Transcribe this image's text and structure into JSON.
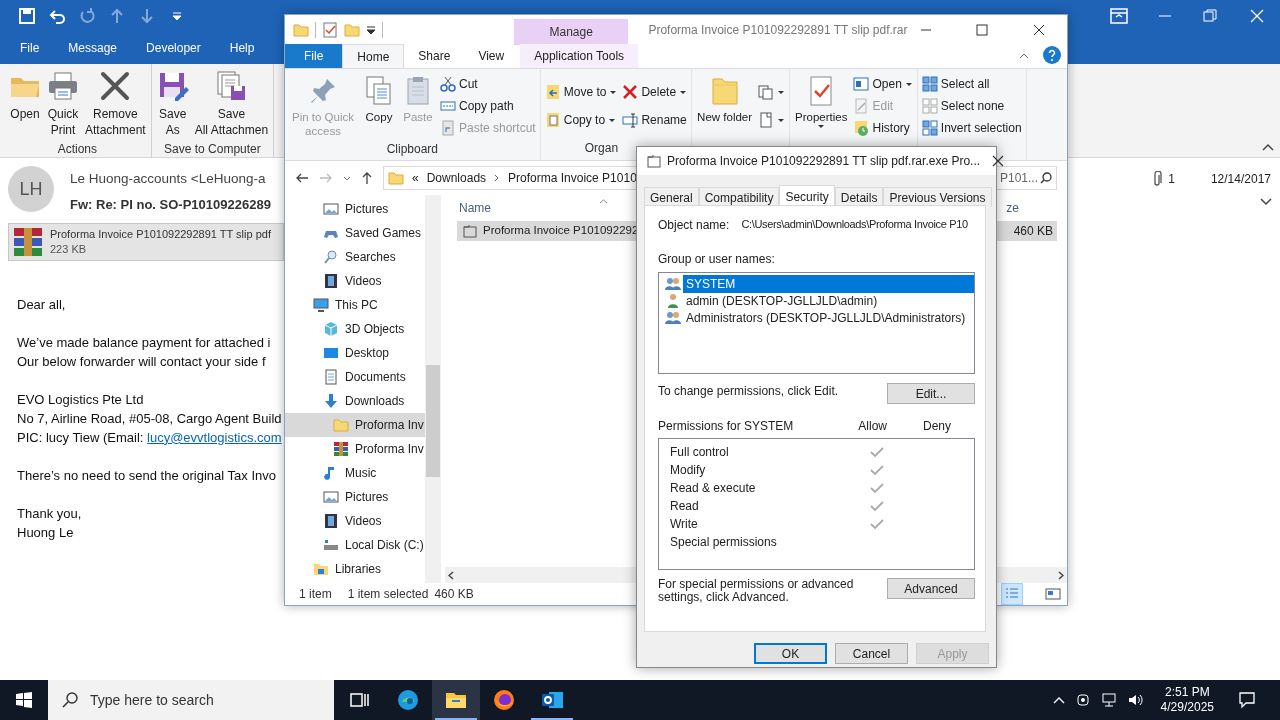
{
  "outlook": {
    "quick_access": [
      {
        "disabled": false
      },
      {
        "disabled": false
      },
      {
        "disabled": true
      },
      {
        "disabled": true
      },
      {
        "disabled": true
      },
      {
        "disabled": false
      }
    ],
    "menu_tabs": [
      {
        "label": "File"
      },
      {
        "label": "Message"
      },
      {
        "label": "Developer"
      },
      {
        "label": "Help"
      }
    ],
    "ribbon_groups": [
      {
        "label": "Actions",
        "buttons": [
          {
            "label": "Open"
          },
          {
            "label": "Quick Print"
          },
          {
            "label": "Remove Attachment"
          }
        ]
      },
      {
        "label": "Save to Computer",
        "buttons": [
          {
            "label": "Save As"
          },
          {
            "label": "Save All Attachmen"
          }
        ]
      }
    ],
    "message": {
      "avatar": "LH",
      "sender": "Le Huong-accounts <LeHuong-a",
      "subject": "Fw: Re: PI no. SO-P10109226289",
      "attachment_count": "1",
      "date": "12/14/2017",
      "attachment": {
        "name": "Proforma Invoice P101092292891 TT slip pdf",
        "size": "223 KB"
      },
      "body": [
        [
          {
            "text": "Dear all,"
          }
        ],
        [
          {
            "text": "We’ve made balance payment for attached i"
          },
          {
            "text": "Our below forwarder will contact your side f"
          }
        ],
        [
          {
            "text": "EVO Logistics Pte Ltd"
          },
          {
            "text": "No 7, Airline Road, #05-08, Cargo Agent Build"
          },
          {
            "text": "PIC: lucy Tiew (Email:",
            "link": "lucy@evvtlogistics.com"
          }
        ],
        [
          {
            "text": "There’s no need to send the original Tax Invo"
          }
        ],
        [
          {
            "text": "Thank you,"
          },
          {
            "text": "Huong Le"
          }
        ]
      ]
    }
  },
  "explorer": {
    "title": "Proforma Invoice P101092292891 TT slip pdf.rar",
    "context_group": "Manage",
    "tabs": [
      {
        "label": "File",
        "kind": "file",
        "selected": false
      },
      {
        "label": "Home",
        "kind": "tab",
        "selected": true
      },
      {
        "label": "Share",
        "kind": "tab",
        "selected": false
      },
      {
        "label": "View",
        "kind": "tab",
        "selected": false
      },
      {
        "label": "Application Tools",
        "kind": "context",
        "selected": false
      }
    ],
    "ribbon": [
      {
        "label": "Clipboard",
        "items": [
          {
            "kind": "large",
            "label": "Pin to Quick access",
            "disabled": true
          },
          {
            "kind": "large",
            "label": "Copy",
            "disabled": false
          },
          {
            "kind": "large",
            "label": "Paste",
            "disabled": true
          },
          {
            "kind": "stack",
            "items": [
              {
                "label": "Cut",
                "disabled": false
              },
              {
                "label": "Copy path",
                "disabled": false
              },
              {
                "label": "Paste shortcut",
                "disabled": true
              }
            ]
          }
        ]
      },
      {
        "label": "Organ",
        "items": [
          {
            "kind": "stack",
            "items": [
              {
                "label": "Move to",
                "dropdown": true
              },
              {
                "label": "Copy to",
                "dropdown": true
              }
            ]
          },
          {
            "kind": "stack",
            "items": [
              {
                "label": "Delete",
                "dropdown": true
              },
              {
                "label": "Rename"
              }
            ]
          }
        ]
      },
      {
        "items": [
          {
            "kind": "large",
            "label": "New folder"
          },
          {
            "kind": "stack",
            "items": [
              {
                "dropdown": true
              },
              {
                "dropdown": true
              }
            ]
          }
        ]
      },
      {
        "items": [
          {
            "kind": "large",
            "label": "Properties",
            "dropdown": true
          },
          {
            "kind": "stack",
            "items": [
              {
                "label": "Open",
                "dropdown": true
              },
              {
                "label": "Edit",
                "disabled": true
              },
              {
                "label": "History"
              }
            ]
          }
        ]
      },
      {
        "items": [
          {
            "kind": "stack",
            "items": [
              {
                "label": "Select all"
              },
              {
                "label": "Select none"
              },
              {
                "label": "Invert selection"
              }
            ]
          }
        ]
      }
    ],
    "address": {
      "overflow": "«",
      "crumbs": [
        "Downloads",
        "Proforma Invoice P1010"
      ]
    },
    "search": {
      "placeholder": "P101..."
    },
    "tree": [
      {
        "children": [
          {
            "label": "Pictures",
            "selected": false
          },
          {
            "label": "Saved Games",
            "selected": false
          },
          {
            "label": "Searches",
            "selected": false
          },
          {
            "label": "Videos",
            "selected": false
          }
        ]
      },
      {
        "label": "This PC",
        "selected": false,
        "children": [
          {
            "label": "3D Objects",
            "selected": false
          },
          {
            "label": "Desktop",
            "selected": false
          },
          {
            "label": "Documents",
            "selected": false
          },
          {
            "label": "Downloads",
            "selected": false,
            "children": [
              {
                "label": "Proforma Inv",
                "selected": true
              },
              {
                "label": "Proforma Inv",
                "selected": false
              }
            ]
          },
          {
            "label": "Music",
            "selected": false
          },
          {
            "label": "Pictures",
            "selected": false
          },
          {
            "label": "Videos",
            "selected": false
          },
          {
            "label": "Local Disk (C:)",
            "selected": false
          }
        ]
      },
      {
        "label": "Libraries",
        "selected": false
      }
    ],
    "columns": [
      {
        "label": "Name"
      },
      {
        "label": "ze"
      }
    ],
    "rows": [
      {
        "name": "Proforma Invoice P101092292",
        "size": "460 KB",
        "selected": true
      }
    ],
    "status": {
      "count": "1 item",
      "selection": "1 item selected",
      "size": "460 KB"
    },
    "view_buttons": [
      {
        "selected": true
      },
      {
        "selected": false
      }
    ]
  },
  "dialog": {
    "title": "Proforma Invoice P101092292891 TT slip pdf.rar.exe Pro...",
    "tabs": [
      {
        "label": "General",
        "selected": false
      },
      {
        "label": "Compatibility",
        "selected": false
      },
      {
        "label": "Security",
        "selected": true
      },
      {
        "label": "Details",
        "selected": false
      },
      {
        "label": "Previous Versions",
        "selected": false
      }
    ],
    "object_label": "Object name:",
    "object_name": "C:\\Users\\admin\\Downloads\\Proforma Invoice P10",
    "group_label": "Group or user names:",
    "principals": [
      {
        "name": "SYSTEM",
        "kind": "group",
        "selected": true
      },
      {
        "name": "admin (DESKTOP-JGLLJLD\\admin)",
        "kind": "user",
        "selected": false
      },
      {
        "name": "Administrators (DESKTOP-JGLLJLD\\Administrators)",
        "kind": "group",
        "selected": false
      }
    ],
    "edit_hint": "To change permissions, click Edit.",
    "edit_button": "Edit...",
    "permissions_label": "Permissions for SYSTEM",
    "allow_label": "Allow",
    "deny_label": "Deny",
    "permissions": [
      {
        "name": "Full control",
        "allow": true,
        "deny": false
      },
      {
        "name": "Modify",
        "allow": true,
        "deny": false
      },
      {
        "name": "Read & execute",
        "allow": true,
        "deny": false
      },
      {
        "name": "Read",
        "allow": true,
        "deny": false
      },
      {
        "name": "Write",
        "allow": true,
        "deny": false
      },
      {
        "name": "Special permissions",
        "allow": false,
        "deny": false
      }
    ],
    "advanced_hint": "For special permissions or advanced settings, click Advanced.",
    "advanced_button": "Advanced",
    "buttons": [
      {
        "label": "OK",
        "kind": "default",
        "disabled": false
      },
      {
        "label": "Cancel",
        "kind": "normal",
        "disabled": false
      },
      {
        "label": "Apply",
        "kind": "normal",
        "disabled": true
      }
    ]
  },
  "taskbar": {
    "search_placeholder": "Type here to search",
    "apps": [
      {
        "kind": "taskview",
        "active": false,
        "running": false
      },
      {
        "kind": "edge",
        "active": false,
        "running": false
      },
      {
        "kind": "explorer",
        "active": true,
        "running": true
      },
      {
        "kind": "firefox",
        "active": false,
        "running": false
      },
      {
        "kind": "outlook",
        "active": false,
        "running": true
      }
    ],
    "time": "2:51 PM",
    "date": "4/29/2025"
  }
}
